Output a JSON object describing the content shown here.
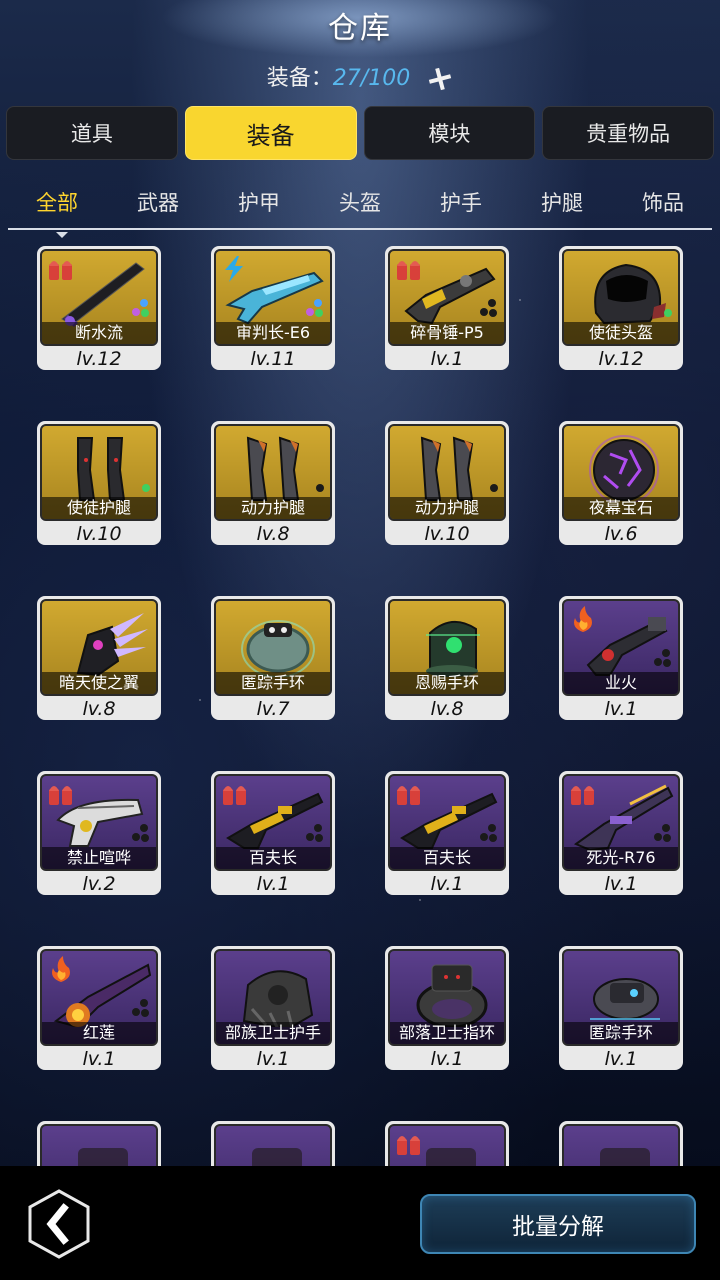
{
  "header": {
    "title": "仓库"
  },
  "capacity": {
    "label": "装备：",
    "value": "27/100",
    "add_icon": "plus-icon"
  },
  "main_tabs": [
    {
      "label": "道具",
      "active": false
    },
    {
      "label": "装备",
      "active": true
    },
    {
      "label": "模块",
      "active": false
    },
    {
      "label": "贵重物品",
      "active": false
    }
  ],
  "sub_tabs": [
    {
      "label": "全部",
      "active": true
    },
    {
      "label": "武器",
      "active": false
    },
    {
      "label": "护甲",
      "active": false
    },
    {
      "label": "头盔",
      "active": false
    },
    {
      "label": "护手",
      "active": false
    },
    {
      "label": "护腿",
      "active": false
    },
    {
      "label": "饰品",
      "active": false
    }
  ],
  "items": [
    {
      "name": "断水流",
      "level": "lv.12",
      "rarity": "gold",
      "art": "sword",
      "badge": "ammo",
      "slots": "colored"
    },
    {
      "name": "审判长-E6",
      "level": "lv.11",
      "rarity": "gold",
      "art": "rifle-blue",
      "badge": "lightning",
      "slots": "colored"
    },
    {
      "name": "碎骨锤-P5",
      "level": "lv.1",
      "rarity": "gold",
      "art": "gun-heavy",
      "badge": "ammo",
      "slots": "dark"
    },
    {
      "name": "使徒头盔",
      "level": "lv.12",
      "rarity": "gold",
      "art": "helmet",
      "badge": "",
      "slots": "green"
    },
    {
      "name": "使徒护腿",
      "level": "lv.10",
      "rarity": "gold",
      "art": "legs",
      "badge": "",
      "slots": "green"
    },
    {
      "name": "动力护腿",
      "level": "lv.8",
      "rarity": "gold",
      "art": "legs-orange",
      "badge": "",
      "slots": "dark-one"
    },
    {
      "name": "动力护腿",
      "level": "lv.10",
      "rarity": "gold",
      "art": "legs-orange",
      "badge": "",
      "slots": "dark-one"
    },
    {
      "name": "夜幕宝石",
      "level": "lv.6",
      "rarity": "gold",
      "art": "gem",
      "badge": "",
      "slots": "none"
    },
    {
      "name": "暗天使之翼",
      "level": "lv.8",
      "rarity": "gold",
      "art": "wing",
      "badge": "",
      "slots": "none"
    },
    {
      "name": "匿踪手环",
      "level": "lv.7",
      "rarity": "gold",
      "art": "bracelet-teal",
      "badge": "",
      "slots": "none"
    },
    {
      "name": "恩赐手环",
      "level": "lv.8",
      "rarity": "gold",
      "art": "bracelet-green",
      "badge": "",
      "slots": "none"
    },
    {
      "name": "业火",
      "level": "lv.1",
      "rarity": "purple",
      "art": "cannon",
      "badge": "fire",
      "slots": "dark"
    },
    {
      "name": "禁止喧哗",
      "level": "lv.2",
      "rarity": "purple",
      "art": "pistol-white",
      "badge": "ammo",
      "slots": "dark"
    },
    {
      "name": "百夫长",
      "level": "lv.1",
      "rarity": "purple",
      "art": "rifle-gold",
      "badge": "ammo",
      "slots": "dark"
    },
    {
      "name": "百夫长",
      "level": "lv.1",
      "rarity": "purple",
      "art": "rifle-gold",
      "badge": "ammo",
      "slots": "dark"
    },
    {
      "name": "死光-R76",
      "level": "lv.1",
      "rarity": "purple",
      "art": "sniper",
      "badge": "ammo",
      "slots": "dark"
    },
    {
      "name": "红莲",
      "level": "lv.1",
      "rarity": "purple",
      "art": "flame-gun",
      "badge": "fire",
      "slots": "dark"
    },
    {
      "name": "部族卫士护手",
      "level": "lv.1",
      "rarity": "purple",
      "art": "gauntlet",
      "badge": "",
      "slots": "none"
    },
    {
      "name": "部落卫士指环",
      "level": "lv.1",
      "rarity": "purple",
      "art": "ring",
      "badge": "",
      "slots": "none"
    },
    {
      "name": "匿踪手环",
      "level": "lv.1",
      "rarity": "purple",
      "art": "bracelet-tech",
      "badge": "",
      "slots": "none"
    },
    {
      "name": "",
      "level": "",
      "rarity": "purple",
      "art": "partial",
      "badge": "",
      "slots": "none"
    },
    {
      "name": "",
      "level": "",
      "rarity": "purple",
      "art": "partial",
      "badge": "",
      "slots": "none"
    },
    {
      "name": "",
      "level": "",
      "rarity": "purple",
      "art": "partial",
      "badge": "ammo",
      "slots": "none"
    },
    {
      "name": "",
      "level": "",
      "rarity": "purple",
      "art": "partial",
      "badge": "",
      "slots": "none"
    }
  ],
  "bottom": {
    "back_icon": "back-arrow-icon",
    "decompose_label": "批量分解"
  }
}
